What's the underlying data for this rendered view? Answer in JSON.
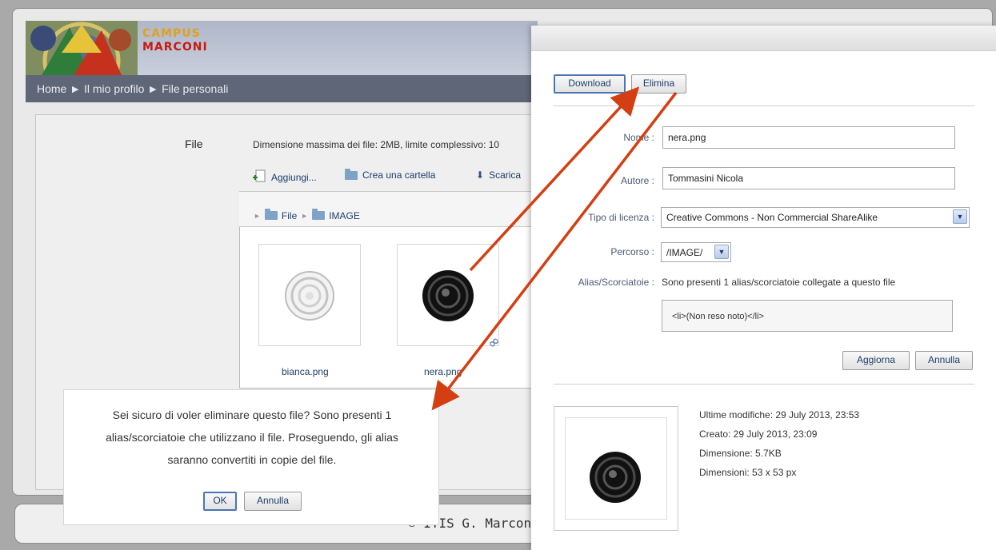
{
  "site": {
    "logo_line1": "CAMPUS",
    "logo_line2": "MARCONI",
    "breadcrumb": "Home ► Il mio profilo ► File personali",
    "footer": "© ITIS G. Marconi"
  },
  "filemanager": {
    "label": "File",
    "maxsize": "Dimensione massima dei file: 2MB, limite complessivo: 10",
    "toolbar": {
      "add": "Aggiungi...",
      "new_folder": "Crea una cartella",
      "download": "Scarica"
    },
    "path": [
      "File",
      "IMAGE"
    ],
    "files": [
      {
        "name": "bianca.png"
      },
      {
        "name": "nera.png"
      }
    ]
  },
  "details_dialog": {
    "download_button": "Download",
    "delete_button": "Elimina",
    "name_label": "Nome :",
    "name_value": "nera.png",
    "author_label": "Autore :",
    "author_value": "Tommasini Nicola",
    "license_label": "Tipo di licenza :",
    "license_value": "Creative Commons - Non Commercial ShareAlike",
    "path_label": "Percorso :",
    "path_value": "/IMAGE/",
    "alias_label": "Alias/Scorciatoie :",
    "alias_value": "Sono presenti 1 alias/scorciatoie collegate a questo file",
    "alias_list": "<li>(Non reso noto)</li>",
    "update_button": "Aggiorna",
    "cancel_button": "Annulla",
    "meta": {
      "modified": "Ultime modifiche: 29 July 2013, 23:53",
      "created": "Creato: 29 July 2013, 23:09",
      "size": "Dimensione: 5.7KB",
      "dimensions": "Dimensioni: 53 x 53 px"
    }
  },
  "confirm_dialog": {
    "line1": "Sei sicuro di voler eliminare questo file? Sono presenti 1",
    "line2": "alias/scorciatoie che utilizzano il file. Proseguendo, gli alias",
    "line3": "saranno convertiti in copie del file.",
    "ok_button": "OK",
    "cancel_button": "Annulla"
  },
  "colors": {
    "annotation_arrow": "#d33f12",
    "breadcrumb_bar": "#5f6677",
    "link_text": "#1d3e6b"
  }
}
